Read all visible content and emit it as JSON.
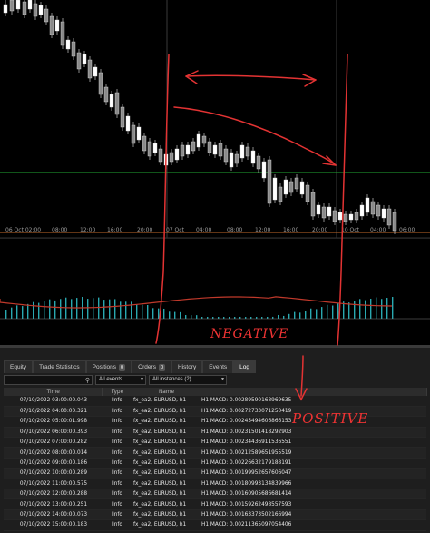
{
  "time_axis": [
    "06 Oct 02:00",
    "08:00",
    "12:00",
    "16:00",
    "20:00",
    "07 Oct",
    "04:00",
    "08:00",
    "12:00",
    "16:00",
    "20:00",
    "10 Oct",
    "04:00",
    "06:00"
  ],
  "tabs": [
    {
      "label": "Equity",
      "badge": ""
    },
    {
      "label": "Trade Statistics",
      "badge": ""
    },
    {
      "label": "Positions",
      "badge": "0"
    },
    {
      "label": "Orders",
      "badge": "0"
    },
    {
      "label": "History",
      "badge": ""
    },
    {
      "label": "Events",
      "badge": ""
    },
    {
      "label": "Log",
      "badge": ""
    }
  ],
  "filters": {
    "search_value": "",
    "events_select": "All events",
    "instances_select": "All instances (2)"
  },
  "log_table": {
    "columns": [
      "Time",
      "Type",
      "Name",
      ""
    ],
    "rows": [
      [
        "07/10/2022 03:00:00.043",
        "Info",
        "fx_ea2, EURUSD, h1",
        "H1 MACD: 0.00289590168969635"
      ],
      [
        "07/10/2022 04:00:00.321",
        "Info",
        "fx_ea2, EURUSD, h1",
        "H1 MACD: 0.00272733071250419"
      ],
      [
        "07/10/2022 05:00:01.998",
        "Info",
        "fx_ea2, EURUSD, h1",
        "H1 MACD: 0.00245494606866153"
      ],
      [
        "07/10/2022 06:00:00.393",
        "Info",
        "fx_ea2, EURUSD, h1",
        "H1 MACD: 0.00231501418292903"
      ],
      [
        "07/10/2022 07:00:00.282",
        "Info",
        "fx_ea2, EURUSD, h1",
        "H1 MACD: 0.00234436911536551"
      ],
      [
        "07/10/2022 08:00:00.014",
        "Info",
        "fx_ea2, EURUSD, h1",
        "H1 MACD: 0.00212589651955519"
      ],
      [
        "07/10/2022 09:00:00.186",
        "Info",
        "fx_ea2, EURUSD, h1",
        "H1 MACD: 0.00226632179188191"
      ],
      [
        "07/10/2022 10:00:00.289",
        "Info",
        "fx_ea2, EURUSD, h1",
        "H1 MACD: 0.00199952657606047"
      ],
      [
        "07/10/2022 11:00:00.575",
        "Info",
        "fx_ea2, EURUSD, h1",
        "H1 MACD: 0.00180993134839966"
      ],
      [
        "07/10/2022 12:00:00.288",
        "Info",
        "fx_ea2, EURUSD, h1",
        "H1 MACD: 0.00160905686681414"
      ],
      [
        "07/10/2022 13:00:00.251",
        "Info",
        "fx_ea2, EURUSD, h1",
        "H1 MACD: 0.00159262498557593"
      ],
      [
        "07/10/2022 14:00:00.073",
        "Info",
        "fx_ea2, EURUSD, h1",
        "H1 MACD: 0.00163373502166994"
      ],
      [
        "07/10/2022 15:00:00.183",
        "Info",
        "fx_ea2, EURUSD, h1",
        "H1 MACD: 0.00211365097054406"
      ]
    ]
  },
  "annotations": {
    "negative": "NEGATIVE",
    "positive": "POSITIVE"
  },
  "colors": {
    "bull_candle": "#ffffff",
    "bear_candle": "#8a8a8a",
    "level_green": "#22aa33",
    "level_orange": "#c56a2a",
    "macd_hist": "#2aa8b0",
    "macd_signal": "#c0392b",
    "annotation_red": "#e33333"
  }
}
